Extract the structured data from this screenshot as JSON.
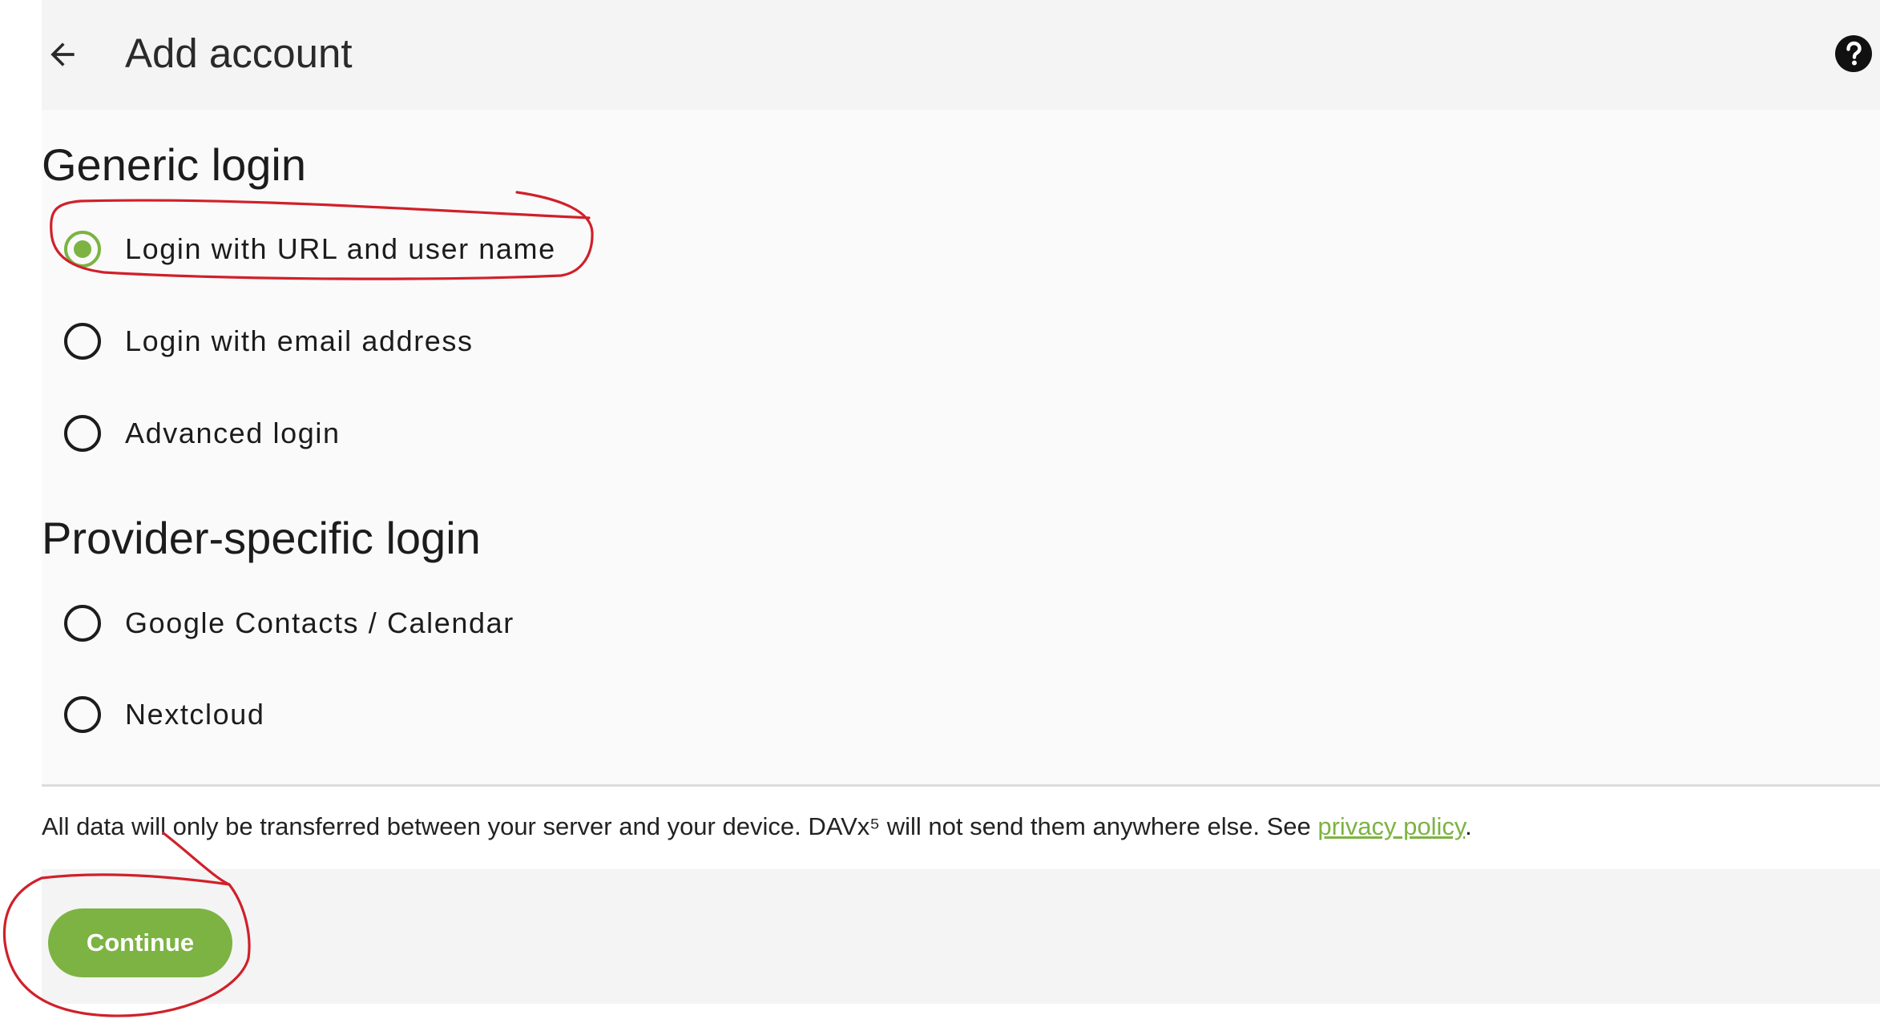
{
  "app_bar": {
    "title": "Add account",
    "back_icon": "arrow-left-icon",
    "help_icon": "help-circle-icon"
  },
  "generic_login": {
    "heading": "Generic login",
    "options": [
      {
        "label": "Login with URL and user name",
        "selected": true
      },
      {
        "label": "Login with email address",
        "selected": false
      },
      {
        "label": "Advanced login",
        "selected": false
      }
    ]
  },
  "provider_login": {
    "heading": "Provider-specific login",
    "options": [
      {
        "label": "Google Contacts / Calendar",
        "selected": false
      },
      {
        "label": "Nextcloud",
        "selected": false
      }
    ]
  },
  "footer": {
    "text_before": "All data will only be transferred between your server and your device. DAVx⁵ will not send them anywhere else. See ",
    "link_text": "privacy policy",
    "text_after": "."
  },
  "actions": {
    "continue_label": "Continue"
  },
  "colors": {
    "accent": "#7cb342",
    "annotation": "#d0202a",
    "app_bar_bg": "#f4f4f4",
    "content_bg": "#fafafa"
  }
}
